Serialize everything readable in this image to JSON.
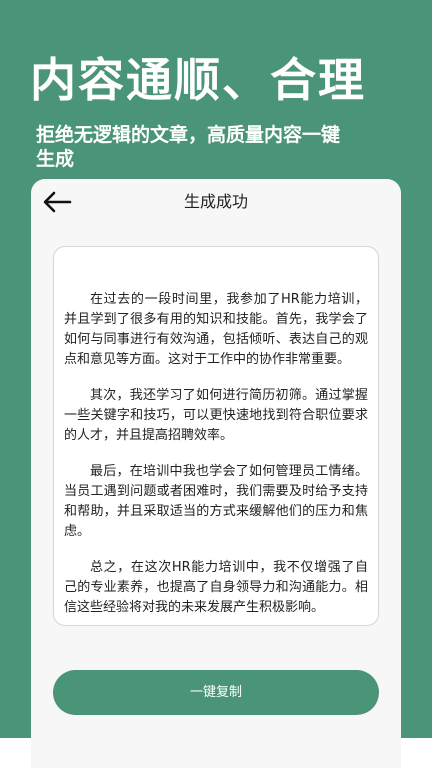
{
  "hero": {
    "title": "内容通顺、合理",
    "subtitle": "拒绝无逻辑的文章，高质量内容一键生成"
  },
  "card": {
    "back_icon": "arrow-left-icon",
    "title": "生成成功",
    "paragraphs": [
      "在过去的一段时间里，我参加了HR能力培训，并且学到了很多有用的知识和技能。首先，我学会了如何与同事进行有效沟通，包括倾听、表达自己的观点和意见等方面。这对于工作中的协作非常重要。",
      "其次，我还学习了如何进行简历初筛。通过掌握一些关键字和技巧，可以更快速地找到符合职位要求的人才，并且提高招聘效率。",
      "最后，在培训中我也学会了如何管理员工情绪。当员工遇到问题或者困难时，我们需要及时给予支持和帮助，并且采取适当的方式来缓解他们的压力和焦虑。",
      "总之，在这次HR能力培训中，我不仅增强了自己的专业素养，也提高了自身领导力和沟通能力。相信这些经验将对我的未来发展产生积极影响。"
    ],
    "copy_button_label": "一键复制"
  },
  "colors": {
    "brand_green": "#4a9478",
    "card_bg": "#f7f7f7",
    "text": "#222222"
  }
}
